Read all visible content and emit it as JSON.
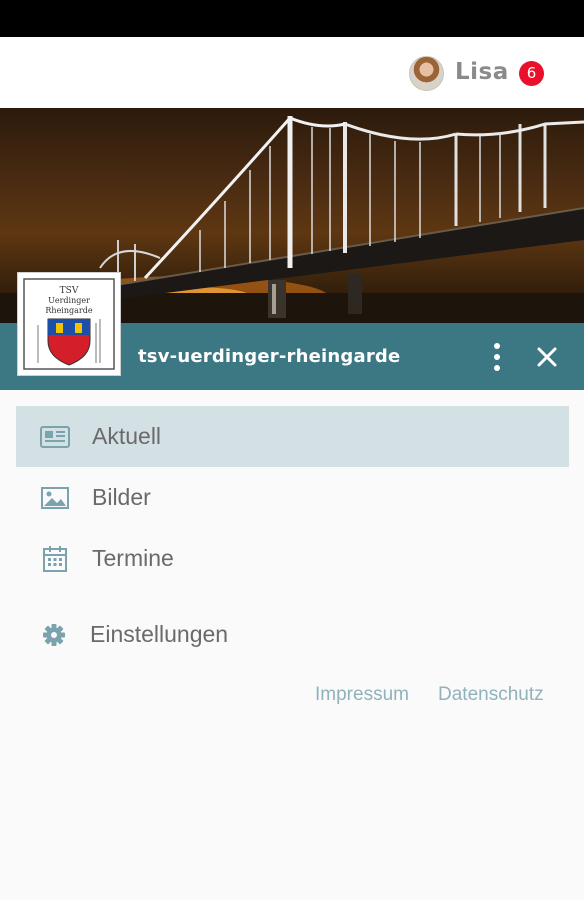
{
  "header": {
    "user_name": "Lisa",
    "notification_count": "6"
  },
  "club": {
    "name": "tsv-uerdinger-rheingarde",
    "logo_text": [
      "TSV",
      "Uerdinger",
      "Rheingarde"
    ]
  },
  "menu": {
    "items": [
      {
        "label": "Aktuell",
        "icon": "newspaper-icon",
        "active": true
      },
      {
        "label": "Bilder",
        "icon": "image-icon",
        "active": false
      },
      {
        "label": "Termine",
        "icon": "calendar-icon",
        "active": false
      },
      {
        "label": "Einstellungen",
        "icon": "gear-icon",
        "active": false
      }
    ]
  },
  "footer": {
    "impressum": "Impressum",
    "datenschutz": "Datenschutz"
  },
  "colors": {
    "accent": "#3c7784",
    "active_bg": "#d3e1e5",
    "badge": "#e8102a",
    "icon": "#7aa3ad"
  }
}
